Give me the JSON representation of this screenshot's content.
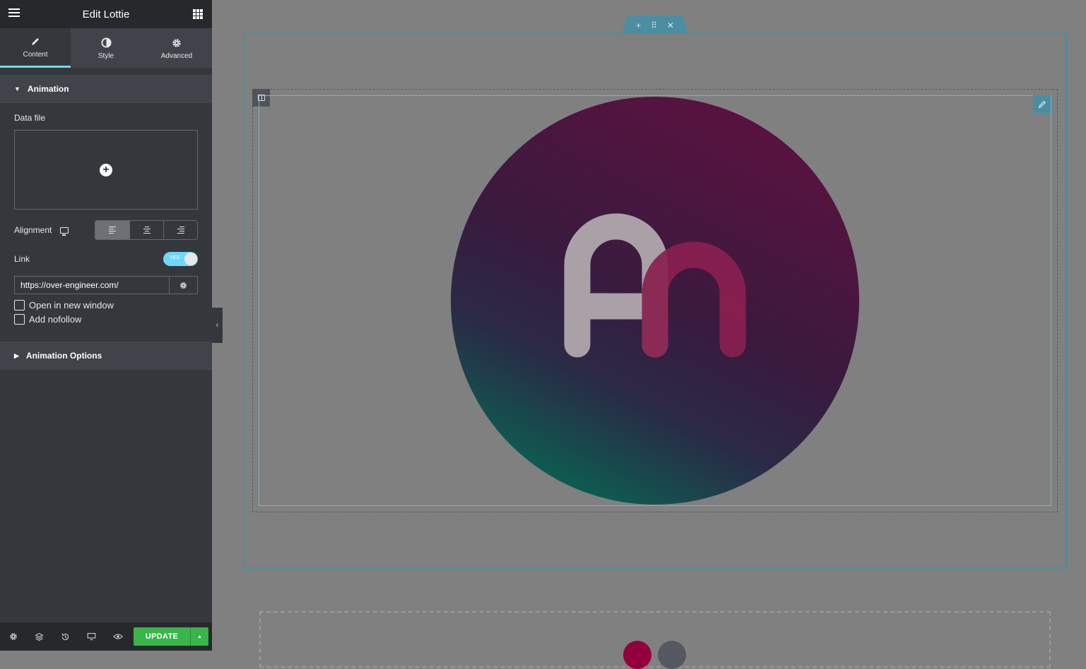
{
  "panel": {
    "title": "Edit Lottie",
    "tabs": [
      {
        "label": "Content",
        "icon": "pencil-icon"
      },
      {
        "label": "Style",
        "icon": "contrast-icon"
      },
      {
        "label": "Advanced",
        "icon": "gear-icon"
      }
    ],
    "animation_section": {
      "title": "Animation",
      "data_file_label": "Data file",
      "alignment_label": "Alignment",
      "link_label": "Link",
      "link_toggle_text": "YES",
      "url_value": "https://over-engineer.com/",
      "open_new_window_label": "Open in new window",
      "add_nofollow_label": "Add nofollow"
    },
    "animation_options_title": "Animation Options"
  },
  "footer": {
    "update_label": "UPDATE",
    "icons": [
      "settings-icon",
      "layers-icon",
      "history-icon",
      "responsive-icon",
      "preview-eye-icon"
    ]
  },
  "colors": {
    "panel_bg": "#34383c",
    "accent_blue": "#71d7f7",
    "update_green": "#39b54a",
    "section_outline": "#4b8ea3"
  }
}
